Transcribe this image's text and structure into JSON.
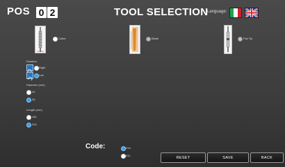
{
  "header": {
    "pos_label": "POS",
    "pos_digits": [
      "0",
      "2"
    ],
    "title": "TOOL SELECTION",
    "language_label": "Language:",
    "languages": [
      {
        "name": "italian-flag-icon",
        "colors": [
          "#1aa64a",
          "#ffffff",
          "#d32030"
        ]
      },
      {
        "name": "uk-flag-icon",
        "colors": [
          "#1c3f94",
          "#ffffff",
          "#d32030"
        ]
      }
    ]
  },
  "tools": [
    {
      "label": "Cutter",
      "selected": true
    },
    {
      "label": "Blade",
      "selected": false
    },
    {
      "label": "Flat Tip",
      "selected": false
    }
  ],
  "rotation": {
    "title": "Rotation",
    "options": [
      {
        "label": "Right",
        "selected": false
      },
      {
        "label": "Left",
        "selected": true
      }
    ]
  },
  "diameter": {
    "title": "Diameter (mm)",
    "options": [
      {
        "label": "20",
        "selected": false
      },
      {
        "label": "28",
        "selected": true
      }
    ]
  },
  "length": {
    "title": "Length (mm)",
    "options": [
      {
        "label": "160",
        "selected": false
      },
      {
        "label": "200",
        "selected": true
      }
    ]
  },
  "code": {
    "label": "Code:",
    "options": [
      {
        "label": "E10",
        "selected": true
      },
      {
        "label": "E11",
        "selected": false
      }
    ]
  },
  "buttons": {
    "reset": "RESET",
    "save": "SAVE",
    "back": "BACK"
  },
  "colors": {
    "accent": "#3b9ee8",
    "background": "#3c3c3c"
  }
}
